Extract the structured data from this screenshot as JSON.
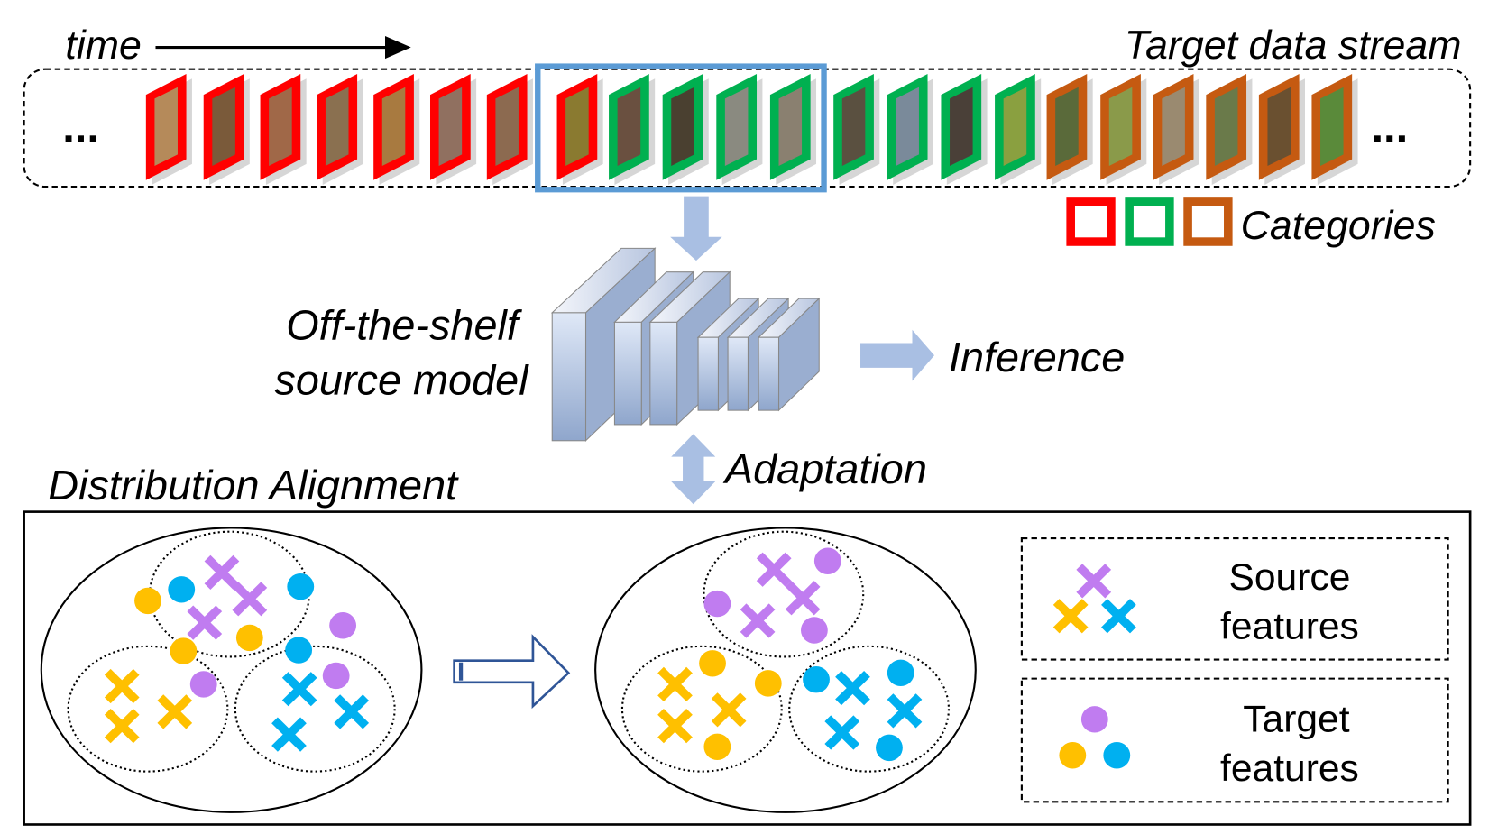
{
  "labels": {
    "time": "time",
    "stream_title": "Target data stream",
    "ellipsis_left": "...",
    "ellipsis_right": "...",
    "categories": "Categories",
    "model_line1": "Off-the-shelf",
    "model_line2": "source model",
    "inference": "Inference",
    "adaptation": "Adaptation",
    "alignment_title": "Distribution Alignment",
    "legend_source_line1": "Source",
    "legend_source_line2": "features",
    "legend_target_line1": "Target",
    "legend_target_line2": "features"
  },
  "colors": {
    "red": "#ff0000",
    "green": "#00b050",
    "orange": "#c55a11",
    "window": "#5b9bd5",
    "arrow": "#a9bfe3",
    "purple": "#c07cf0",
    "yellow": "#ffc000",
    "blue": "#00b0f0",
    "outline_arrow": "#2f5597"
  },
  "stream_frames": [
    "red",
    "red",
    "red",
    "red",
    "red",
    "red",
    "red",
    "red",
    "green",
    "green",
    "green",
    "green",
    "green",
    "green",
    "green",
    "green",
    "orange",
    "orange",
    "orange",
    "orange",
    "orange",
    "orange"
  ],
  "category_swatches": [
    "red",
    "green",
    "orange"
  ],
  "icons": {
    "time_arrow": "right-arrow-icon",
    "down_arrow": "down-arrow-icon",
    "inference_arrow": "right-arrow-icon",
    "adaptation_arrow": "up-down-arrow-icon",
    "transform_arrow": "outline-right-arrow-icon"
  }
}
